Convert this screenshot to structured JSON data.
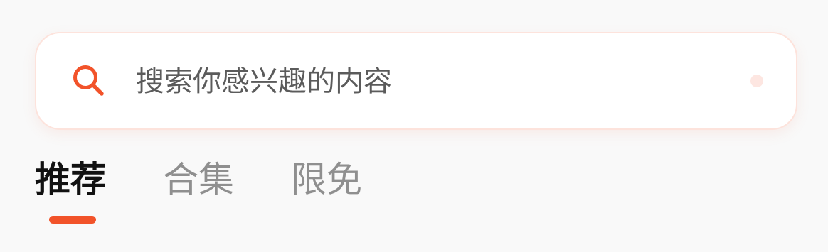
{
  "search": {
    "placeholder": "搜索你感兴趣的内容",
    "icon": "search-icon",
    "accent_color": "#f2532a"
  },
  "tabs": [
    {
      "label": "推荐",
      "active": true
    },
    {
      "label": "合集",
      "active": false
    },
    {
      "label": "限免",
      "active": false
    }
  ],
  "colors": {
    "accent": "#f2532a",
    "active_tab": "#111111",
    "inactive_tab": "#8f8f8f",
    "background": "#f9f9f9"
  }
}
